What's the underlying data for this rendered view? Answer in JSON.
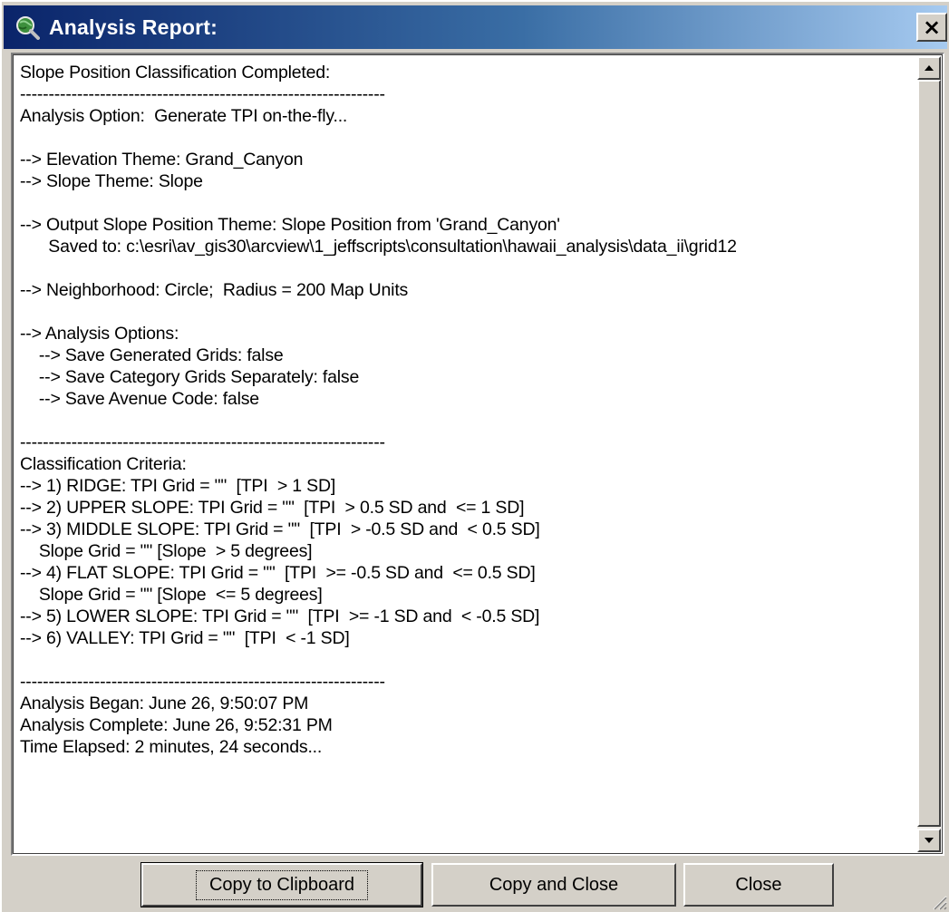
{
  "window": {
    "title": "Analysis Report:",
    "close_glyph": "×",
    "icon": "magnifier-globe-icon"
  },
  "report": {
    "lines": [
      "Slope Position Classification Completed:",
      "----------------------------------------------------------------",
      "Analysis Option:  Generate TPI on-the-fly...",
      "",
      "--> Elevation Theme: Grand_Canyon",
      "--> Slope Theme: Slope",
      "",
      "--> Output Slope Position Theme: Slope Position from 'Grand_Canyon'",
      "      Saved to: c:\\esri\\av_gis30\\arcview\\1_jeffscripts\\consultation\\hawaii_analysis\\data_ii\\grid12",
      "",
      "--> Neighborhood: Circle;  Radius = 200 Map Units",
      "",
      "--> Analysis Options:",
      "    --> Save Generated Grids: false",
      "    --> Save Category Grids Separately: false",
      "    --> Save Avenue Code: false",
      "",
      "----------------------------------------------------------------",
      "Classification Criteria:",
      "--> 1) RIDGE: TPI Grid = \"\"  [TPI  > 1 SD]",
      "--> 2) UPPER SLOPE: TPI Grid = \"\"  [TPI  > 0.5 SD and  <= 1 SD]",
      "--> 3) MIDDLE SLOPE: TPI Grid = \"\"  [TPI  > -0.5 SD and  < 0.5 SD]",
      "    Slope Grid = \"\" [Slope  > 5 degrees]",
      "--> 4) FLAT SLOPE: TPI Grid = \"\"  [TPI  >= -0.5 SD and  <= 0.5 SD]",
      "    Slope Grid = \"\" [Slope  <= 5 degrees]",
      "--> 5) LOWER SLOPE: TPI Grid = \"\"  [TPI  >= -1 SD and  < -0.5 SD]",
      "--> 6) VALLEY: TPI Grid = \"\"  [TPI  < -1 SD]",
      "",
      "----------------------------------------------------------------",
      "Analysis Began: June 26, 9:50:07 PM",
      "Analysis Complete: June 26, 9:52:31 PM",
      "Time Elapsed: 2 minutes, 24 seconds..."
    ]
  },
  "scrollbar": {
    "up_icon": "scroll-up-arrow-icon",
    "down_icon": "scroll-down-arrow-icon"
  },
  "buttons": {
    "copy_to_clipboard": "Copy to Clipboard",
    "copy_and_close": "Copy and Close",
    "close": "Close"
  },
  "colors": {
    "titlebar_start": "#0a246a",
    "titlebar_end": "#a6caf0",
    "face": "#d4d0c8"
  }
}
